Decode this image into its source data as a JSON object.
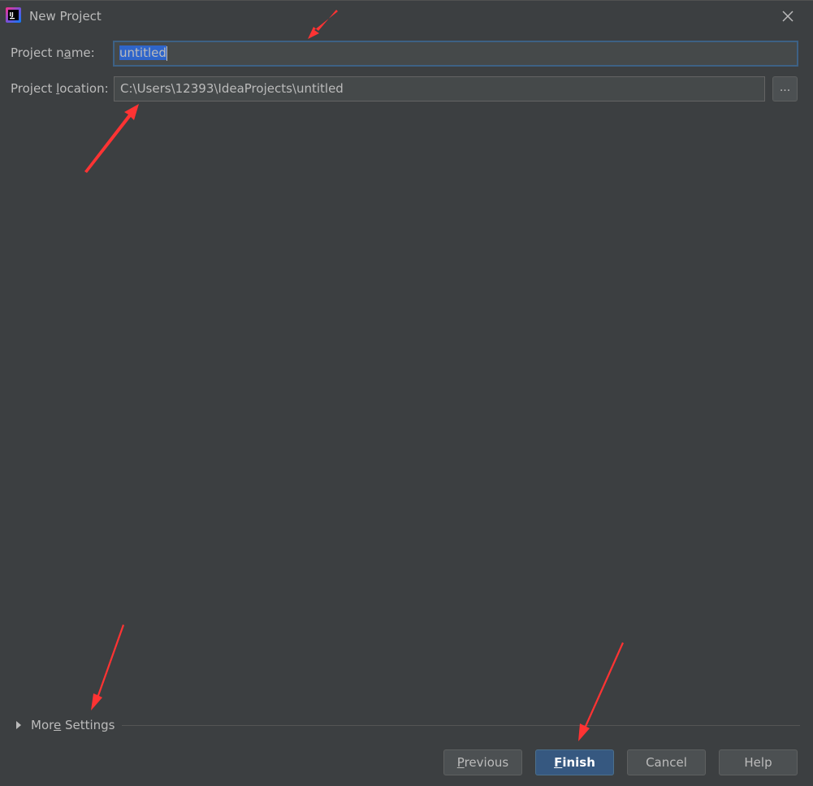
{
  "window": {
    "title": "New Project",
    "icon": "intellij-idea-icon",
    "close_icon": "close-icon"
  },
  "form": {
    "project_name_label_pre": "Project n",
    "project_name_label_mnemonic": "a",
    "project_name_label_post": "me:",
    "project_name_value": "untitled",
    "project_location_label_pre": "Project ",
    "project_location_label_mnemonic": "l",
    "project_location_label_post": "ocation:",
    "project_location_value": "C:\\Users\\12393\\IdeaProjects\\untitled",
    "browse_label": "..."
  },
  "more_settings": {
    "label_pre": "Mor",
    "label_mnemonic": "e",
    "label_post": " Settings",
    "icon": "triangle-right-icon"
  },
  "buttons": {
    "previous_mnemonic": "P",
    "previous_rest": "revious",
    "finish_mnemonic": "F",
    "finish_rest": "inish",
    "cancel": "Cancel",
    "help": "Help"
  },
  "colors": {
    "background": "#3c3f41",
    "primary_button": "#365880",
    "selection": "#2f65ca",
    "annotation_arrow": "#ff3333"
  }
}
